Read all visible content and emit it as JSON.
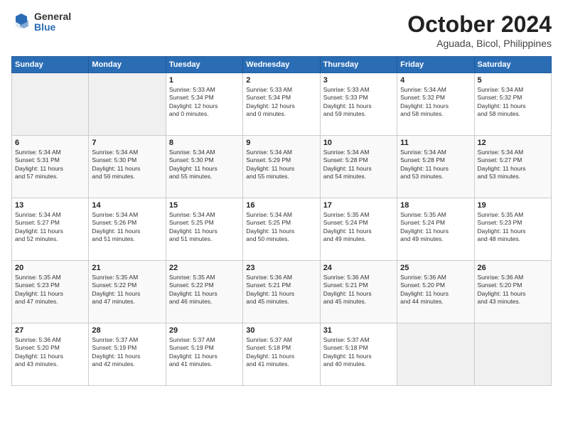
{
  "header": {
    "logo_general": "General",
    "logo_blue": "Blue",
    "month_title": "October 2024",
    "location": "Aguada, Bicol, Philippines"
  },
  "weekdays": [
    "Sunday",
    "Monday",
    "Tuesday",
    "Wednesday",
    "Thursday",
    "Friday",
    "Saturday"
  ],
  "weeks": [
    [
      {
        "day": "",
        "info": ""
      },
      {
        "day": "",
        "info": ""
      },
      {
        "day": "1",
        "info": "Sunrise: 5:33 AM\nSunset: 5:34 PM\nDaylight: 12 hours\nand 0 minutes."
      },
      {
        "day": "2",
        "info": "Sunrise: 5:33 AM\nSunset: 5:34 PM\nDaylight: 12 hours\nand 0 minutes."
      },
      {
        "day": "3",
        "info": "Sunrise: 5:33 AM\nSunset: 5:33 PM\nDaylight: 11 hours\nand 59 minutes."
      },
      {
        "day": "4",
        "info": "Sunrise: 5:34 AM\nSunset: 5:32 PM\nDaylight: 11 hours\nand 58 minutes."
      },
      {
        "day": "5",
        "info": "Sunrise: 5:34 AM\nSunset: 5:32 PM\nDaylight: 11 hours\nand 58 minutes."
      }
    ],
    [
      {
        "day": "6",
        "info": "Sunrise: 5:34 AM\nSunset: 5:31 PM\nDaylight: 11 hours\nand 57 minutes."
      },
      {
        "day": "7",
        "info": "Sunrise: 5:34 AM\nSunset: 5:30 PM\nDaylight: 11 hours\nand 56 minutes."
      },
      {
        "day": "8",
        "info": "Sunrise: 5:34 AM\nSunset: 5:30 PM\nDaylight: 11 hours\nand 55 minutes."
      },
      {
        "day": "9",
        "info": "Sunrise: 5:34 AM\nSunset: 5:29 PM\nDaylight: 11 hours\nand 55 minutes."
      },
      {
        "day": "10",
        "info": "Sunrise: 5:34 AM\nSunset: 5:28 PM\nDaylight: 11 hours\nand 54 minutes."
      },
      {
        "day": "11",
        "info": "Sunrise: 5:34 AM\nSunset: 5:28 PM\nDaylight: 11 hours\nand 53 minutes."
      },
      {
        "day": "12",
        "info": "Sunrise: 5:34 AM\nSunset: 5:27 PM\nDaylight: 11 hours\nand 53 minutes."
      }
    ],
    [
      {
        "day": "13",
        "info": "Sunrise: 5:34 AM\nSunset: 5:27 PM\nDaylight: 11 hours\nand 52 minutes."
      },
      {
        "day": "14",
        "info": "Sunrise: 5:34 AM\nSunset: 5:26 PM\nDaylight: 11 hours\nand 51 minutes."
      },
      {
        "day": "15",
        "info": "Sunrise: 5:34 AM\nSunset: 5:25 PM\nDaylight: 11 hours\nand 51 minutes."
      },
      {
        "day": "16",
        "info": "Sunrise: 5:34 AM\nSunset: 5:25 PM\nDaylight: 11 hours\nand 50 minutes."
      },
      {
        "day": "17",
        "info": "Sunrise: 5:35 AM\nSunset: 5:24 PM\nDaylight: 11 hours\nand 49 minutes."
      },
      {
        "day": "18",
        "info": "Sunrise: 5:35 AM\nSunset: 5:24 PM\nDaylight: 11 hours\nand 49 minutes."
      },
      {
        "day": "19",
        "info": "Sunrise: 5:35 AM\nSunset: 5:23 PM\nDaylight: 11 hours\nand 48 minutes."
      }
    ],
    [
      {
        "day": "20",
        "info": "Sunrise: 5:35 AM\nSunset: 5:23 PM\nDaylight: 11 hours\nand 47 minutes."
      },
      {
        "day": "21",
        "info": "Sunrise: 5:35 AM\nSunset: 5:22 PM\nDaylight: 11 hours\nand 47 minutes."
      },
      {
        "day": "22",
        "info": "Sunrise: 5:35 AM\nSunset: 5:22 PM\nDaylight: 11 hours\nand 46 minutes."
      },
      {
        "day": "23",
        "info": "Sunrise: 5:36 AM\nSunset: 5:21 PM\nDaylight: 11 hours\nand 45 minutes."
      },
      {
        "day": "24",
        "info": "Sunrise: 5:36 AM\nSunset: 5:21 PM\nDaylight: 11 hours\nand 45 minutes."
      },
      {
        "day": "25",
        "info": "Sunrise: 5:36 AM\nSunset: 5:20 PM\nDaylight: 11 hours\nand 44 minutes."
      },
      {
        "day": "26",
        "info": "Sunrise: 5:36 AM\nSunset: 5:20 PM\nDaylight: 11 hours\nand 43 minutes."
      }
    ],
    [
      {
        "day": "27",
        "info": "Sunrise: 5:36 AM\nSunset: 5:20 PM\nDaylight: 11 hours\nand 43 minutes."
      },
      {
        "day": "28",
        "info": "Sunrise: 5:37 AM\nSunset: 5:19 PM\nDaylight: 11 hours\nand 42 minutes."
      },
      {
        "day": "29",
        "info": "Sunrise: 5:37 AM\nSunset: 5:19 PM\nDaylight: 11 hours\nand 41 minutes."
      },
      {
        "day": "30",
        "info": "Sunrise: 5:37 AM\nSunset: 5:18 PM\nDaylight: 11 hours\nand 41 minutes."
      },
      {
        "day": "31",
        "info": "Sunrise: 5:37 AM\nSunset: 5:18 PM\nDaylight: 11 hours\nand 40 minutes."
      },
      {
        "day": "",
        "info": ""
      },
      {
        "day": "",
        "info": ""
      }
    ]
  ]
}
